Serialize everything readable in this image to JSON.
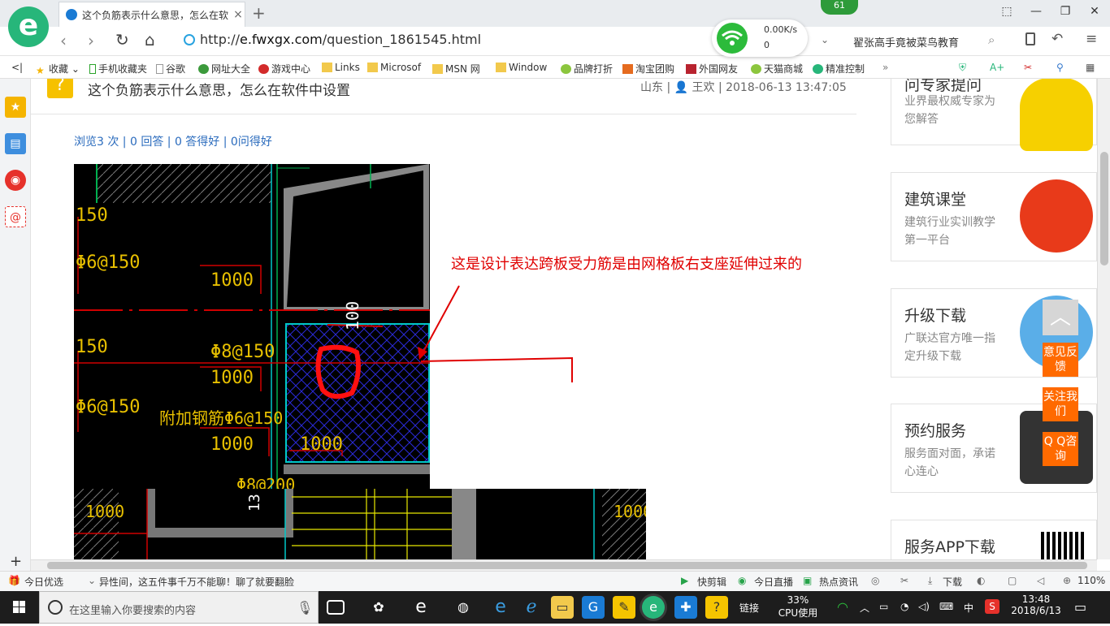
{
  "browser": {
    "tab_title": "这个负筋表示什么意思，怎么在软",
    "tab_close": "×",
    "new_tab": "+",
    "url_prefix": "http://",
    "url_domain": "e.fwxgx.com",
    "url_path": "/question_1861545.html",
    "search_text": "翟张高手竟被菜鸟教育",
    "wifi": {
      "speed_down": "0.00K/s",
      "speed_up": "0"
    },
    "badge": "61"
  },
  "bookmarks": [
    "收藏",
    "手机收藏夹",
    "谷歌",
    "网址大全",
    "游戏中心",
    "Links",
    "Microsof",
    "MSN 网",
    "Window",
    "品牌打折",
    "淘宝团购",
    "外国网友",
    "天猫商城",
    "精准控制"
  ],
  "question": {
    "title": "这个负筋表示什么意思，怎么在软件中设置",
    "meta": "山东 | 👤 王欢 | 2018-06-13 13:47:05",
    "stats": "浏览3 次 | 0 回答 | 0 答得好 | 0问得好",
    "annotation": "这是设计表达跨板受力筋是由网格板右支座延伸过来的"
  },
  "cad": {
    "labels": [
      "150",
      "Φ6@150",
      "1000",
      "150",
      "Φ8@150",
      "1000",
      "Φ6@150",
      "附加钢筋Φ6@150",
      "1000",
      "1000",
      "100",
      "1000",
      "13",
      "1000",
      "Φ8@200"
    ]
  },
  "right_cards": [
    {
      "title": "问专家提问",
      "desc": "业界最权威专家为您解答"
    },
    {
      "title": "建筑课堂",
      "desc": "建筑行业实训教学第一平台"
    },
    {
      "title": "升级下载",
      "desc": "广联达官方唯一指定升级下载"
    },
    {
      "title": "预约服务",
      "desc": "服务面对面，承诺心连心"
    },
    {
      "title": "服务APP下载",
      "desc": ""
    }
  ],
  "float_buttons": [
    "意见反馈",
    "关注我们",
    "Q Q咨询"
  ],
  "statusbar": {
    "left": "今日优选",
    "news": "异性间，这五件事千万不能聊！聊了就要翻脸",
    "items": [
      "快剪辑",
      "今日直播",
      "热点资讯",
      "下载"
    ],
    "zoom": "110%"
  },
  "taskbar": {
    "search_placeholder": "在这里输入你要搜索的内容",
    "link_label": "链接",
    "cpu_percent": "33%",
    "cpu_label": "CPU使用",
    "ime": "中",
    "time": "13:48",
    "date": "2018/6/13"
  }
}
